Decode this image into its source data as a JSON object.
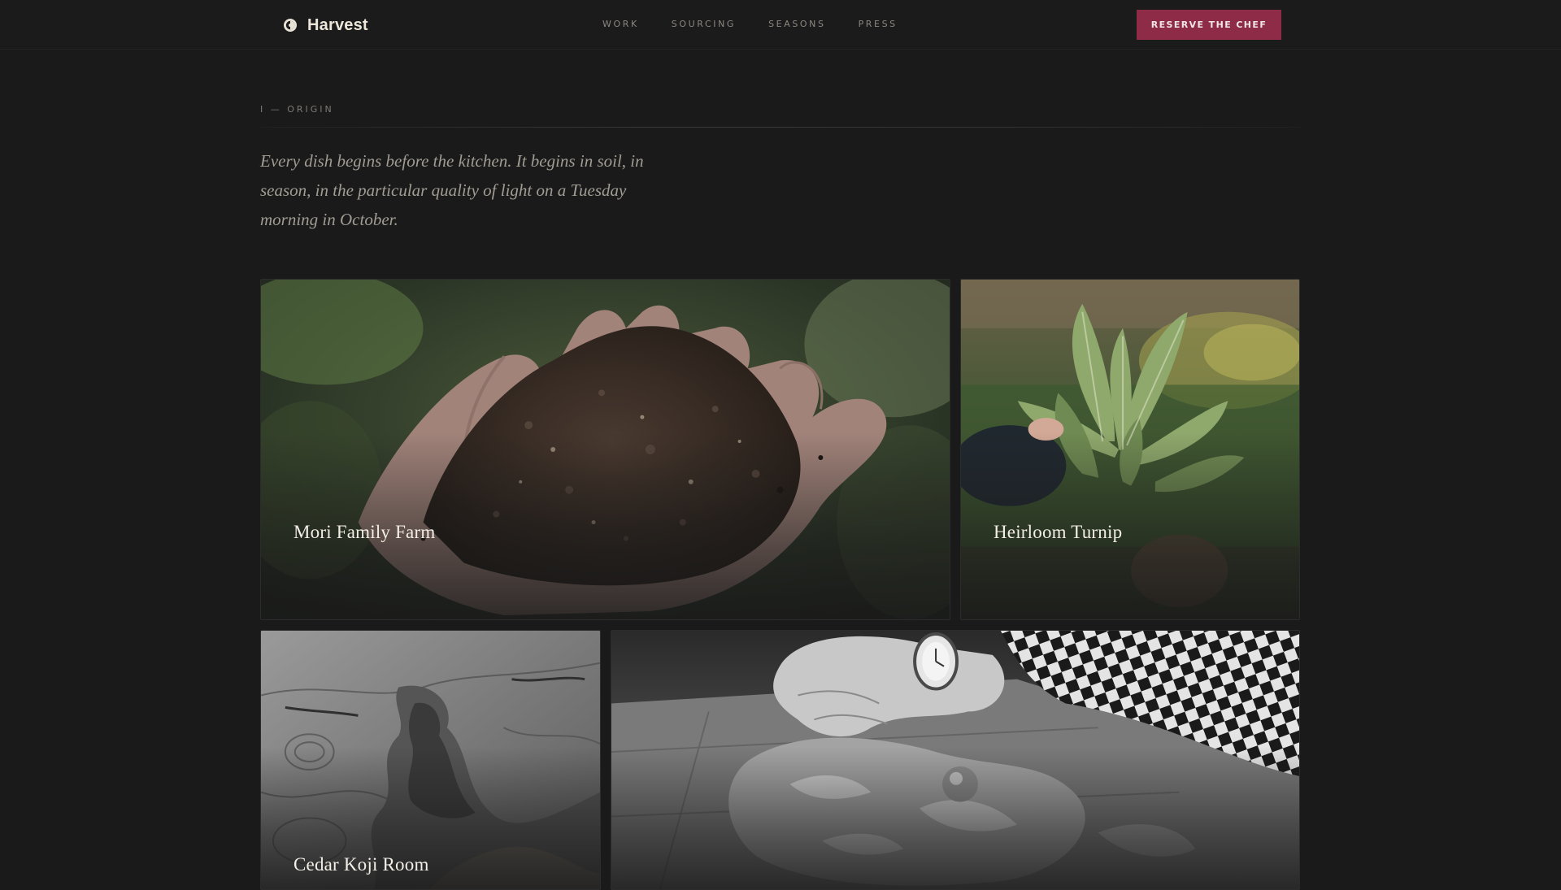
{
  "header": {
    "brand_name": "Harvest",
    "nav": [
      "WORK",
      "SOURCING",
      "SEASONS",
      "PRESS"
    ],
    "cta_label": "RESERVE THE CHEF"
  },
  "intro": {
    "eyebrow": "I — ORIGIN",
    "lede": "Every dish begins before the kitchen. It begins in soil, in season, in the particular quality of light on a Tuesday morning in October."
  },
  "cards": [
    {
      "title": "Mori Family Farm",
      "image": "hand-holding-soil"
    },
    {
      "title": "Heirloom Turnip",
      "image": "harvested-greens"
    },
    {
      "title": "Cedar Koji Room",
      "image": "weathered-cedar-wood"
    },
    {
      "title": "",
      "image": "hands-butchering-meat"
    }
  ],
  "colors": {
    "background": "#1a1a1a",
    "accent": "#8e2c47",
    "text_primary": "#ece6da",
    "text_muted": "#8b8780"
  }
}
